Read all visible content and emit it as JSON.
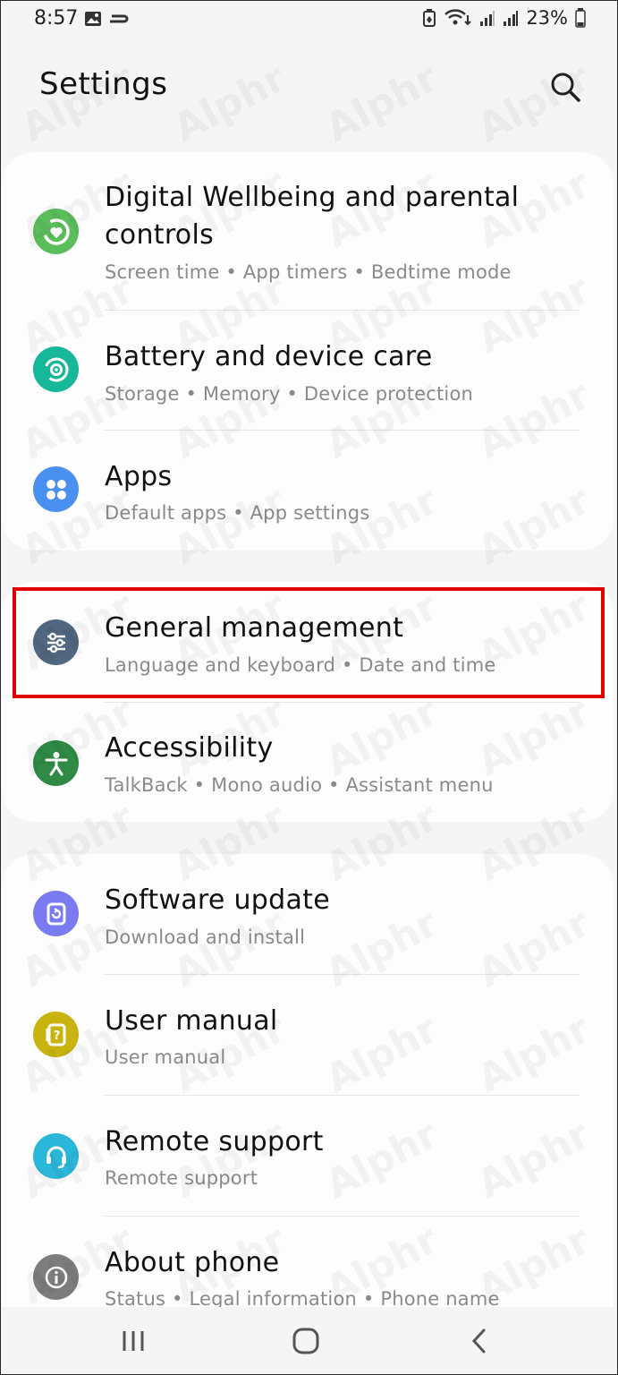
{
  "status_bar": {
    "time": "8:57",
    "battery": "23%"
  },
  "header": {
    "title": "Settings"
  },
  "sections": [
    {
      "items": [
        {
          "title": "Digital Wellbeing and parental controls",
          "subtitle": "Screen time  •  App timers  •  Bedtime mode",
          "icon": "digital-wellbeing-icon",
          "color": "#5cbd5c"
        },
        {
          "title": "Battery and device care",
          "subtitle": "Storage  •  Memory  •  Device protection",
          "icon": "device-care-icon",
          "color": "#17b89a"
        },
        {
          "title": "Apps",
          "subtitle": "Default apps  •  App settings",
          "icon": "apps-icon",
          "color": "#4a90f0"
        }
      ]
    },
    {
      "items": [
        {
          "title": "General management",
          "subtitle": "Language and keyboard  •  Date and time",
          "icon": "general-management-icon",
          "color": "#51677f"
        },
        {
          "title": "Accessibility",
          "subtitle": "TalkBack  •  Mono audio  •  Assistant menu",
          "icon": "accessibility-icon",
          "color": "#2e8a45"
        }
      ]
    },
    {
      "items": [
        {
          "title": "Software update",
          "subtitle": "Download and install",
          "icon": "software-update-icon",
          "color": "#7a7bf0"
        },
        {
          "title": "User manual",
          "subtitle": "User manual",
          "icon": "user-manual-icon",
          "color": "#c9b40f"
        },
        {
          "title": "Remote support",
          "subtitle": "Remote support",
          "icon": "remote-support-icon",
          "color": "#2bb7d9"
        },
        {
          "title": "About phone",
          "subtitle": "Status  •  Legal information  •  Phone name",
          "icon": "about-phone-icon",
          "color": "#7d7d7d"
        }
      ]
    }
  ],
  "watermark": "Alphr"
}
